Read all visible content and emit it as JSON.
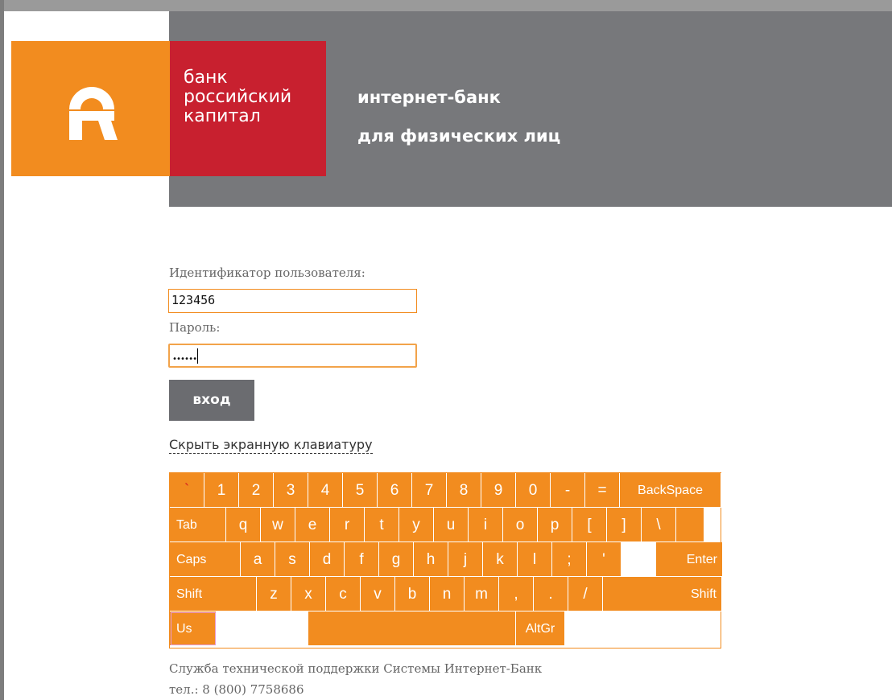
{
  "bank": {
    "name_lines": [
      "банк",
      "российский",
      "капитал"
    ],
    "tagline_lines": [
      "интернет-банк",
      "для физических лиц"
    ],
    "colors": {
      "orange": "#f28c1f",
      "red": "#c8202f",
      "gray": "#77787b"
    }
  },
  "login": {
    "user_id_label": "Идентификатор пользователя:",
    "user_id_value": "123456",
    "password_label": "Пароль:",
    "password_mask": "••••••",
    "submit_label": "вход",
    "toggle_keyboard_label": "Скрыть экранную клавиатуру"
  },
  "keyboard": {
    "row1": [
      "`",
      "1",
      "2",
      "3",
      "4",
      "5",
      "6",
      "7",
      "8",
      "9",
      "0",
      "-",
      "=",
      "BackSpace"
    ],
    "row2": [
      "Tab",
      "q",
      "w",
      "e",
      "r",
      "t",
      "y",
      "u",
      "i",
      "o",
      "p",
      "[",
      "]",
      "\\"
    ],
    "row3": [
      "Caps",
      "a",
      "s",
      "d",
      "f",
      "g",
      "h",
      "j",
      "k",
      "l",
      ";",
      "'",
      "",
      "Enter"
    ],
    "row4": [
      "Shift",
      "z",
      "x",
      "c",
      "v",
      "b",
      "n",
      "m",
      ",",
      ".",
      "/",
      "Shift"
    ],
    "row5": [
      "Us",
      "",
      "",
      "AltGr",
      ""
    ]
  },
  "support": {
    "line1": "Служба технической поддержки Системы Интернет-Банк",
    "line2": "тел.: 8 (800) 7758686"
  }
}
